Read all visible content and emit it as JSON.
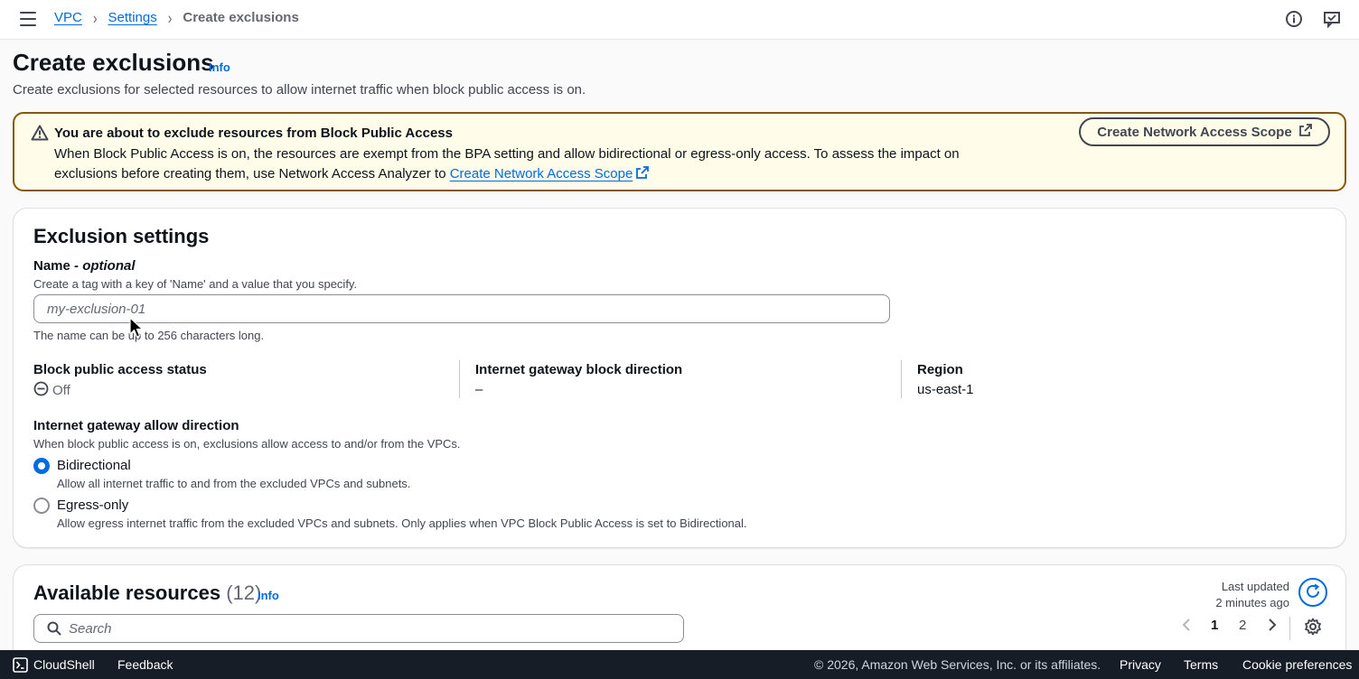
{
  "breadcrumb": {
    "items": [
      "VPC",
      "Settings"
    ],
    "current": "Create exclusions"
  },
  "header": {
    "title": "Create exclusions",
    "info": "Info",
    "description": "Create exclusions for selected resources to allow internet traffic when block public access is on."
  },
  "warning": {
    "title": "You are about to exclude resources from Block Public Access",
    "body_line1": "When Block Public Access is on, the resources are exempt from the BPA setting and allow bidirectional or egress-only access. To assess the impact on",
    "body_line2": "exclusions before creating them, use Network Access Analyzer to ",
    "link": "Create Network Access Scope",
    "button": "Create Network Access Scope"
  },
  "settings": {
    "title": "Exclusion settings",
    "name_label": "Name",
    "name_optional": " - optional",
    "name_desc": "Create a tag with a key of 'Name' and a value that you specify.",
    "name_placeholder": "my-exclusion-01",
    "name_constraint": "The name can be up to 256 characters long.",
    "bpa_status_label": "Block public access status",
    "bpa_status_value": "Off",
    "igw_block_label": "Internet gateway block direction",
    "igw_block_value": "–",
    "region_label": "Region",
    "region_value": "us-east-1",
    "allow_direction_label": "Internet gateway allow direction",
    "allow_direction_desc": "When block public access is on, exclusions allow access to and/or from the VPCs.",
    "options": [
      {
        "label": "Bidirectional",
        "desc": "Allow all internet traffic to and from the excluded VPCs and subnets.",
        "checked": true
      },
      {
        "label": "Egress-only",
        "desc": "Allow egress internet traffic from the excluded VPCs and subnets. Only applies when VPC Block Public Access is set to Bidirectional.",
        "checked": false
      }
    ]
  },
  "resources": {
    "title": "Available resources",
    "count": "(12)",
    "info": "Info",
    "last_updated_label": "Last updated",
    "last_updated_value": "2 minutes ago",
    "search_placeholder": "Search",
    "pages": [
      "1",
      "2"
    ],
    "current_page": "1"
  },
  "footer": {
    "cloudshell": "CloudShell",
    "feedback": "Feedback",
    "copyright": "© 2026, Amazon Web Services, Inc. or its affiliates.",
    "privacy": "Privacy",
    "terms": "Terms",
    "cookies": "Cookie preferences"
  },
  "colors": {
    "link": "#006ce0",
    "warning_border": "#855900",
    "warning_bg": "#fffce9",
    "footer_bg": "#161d26"
  },
  "icons": [
    "menu-icon",
    "chevron-right-icon",
    "info-circle-icon",
    "feedback-icon",
    "warning-icon",
    "external-link-icon",
    "status-stopped-icon",
    "refresh-icon",
    "search-icon",
    "chevron-left-icon",
    "gear-icon",
    "cloudshell-icon",
    "cursor-icon"
  ]
}
